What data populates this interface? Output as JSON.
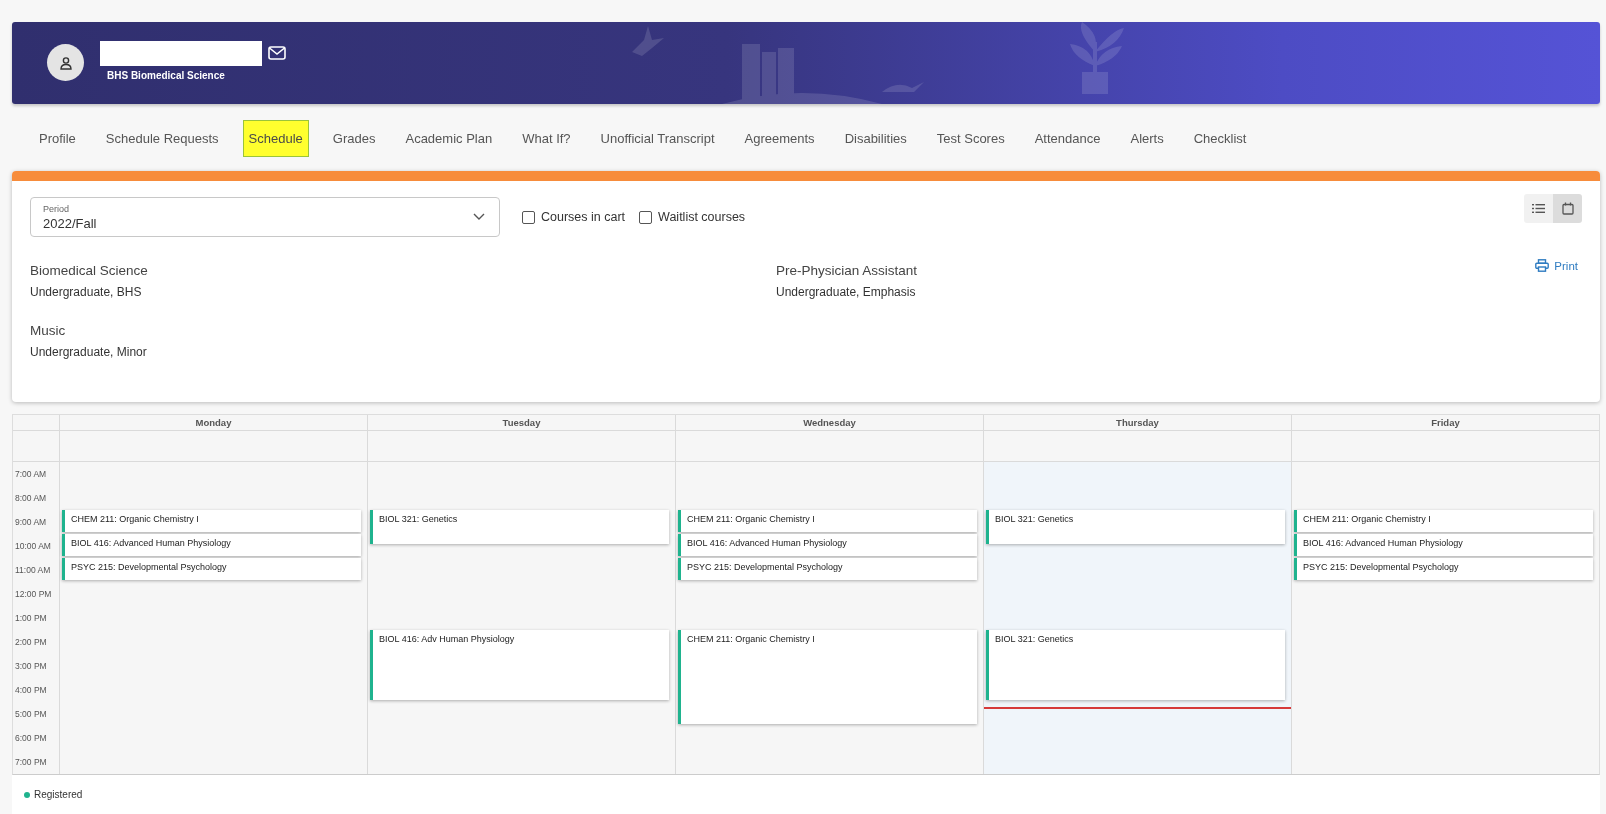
{
  "header": {
    "subtitle": "BHS Biomedical Science"
  },
  "tabs": [
    {
      "label": "Profile",
      "selected": false
    },
    {
      "label": "Schedule Requests",
      "selected": false
    },
    {
      "label": "Schedule",
      "selected": true
    },
    {
      "label": "Grades",
      "selected": false
    },
    {
      "label": "Academic Plan",
      "selected": false
    },
    {
      "label": "What If?",
      "selected": false
    },
    {
      "label": "Unofficial Transcript",
      "selected": false
    },
    {
      "label": "Agreements",
      "selected": false
    },
    {
      "label": "Disabilities",
      "selected": false
    },
    {
      "label": "Test Scores",
      "selected": false
    },
    {
      "label": "Attendance",
      "selected": false
    },
    {
      "label": "Alerts",
      "selected": false
    },
    {
      "label": "Checklist",
      "selected": false
    }
  ],
  "period": {
    "label": "Period",
    "value": "2022/Fall"
  },
  "filters": [
    {
      "label": "Courses in cart",
      "checked": false
    },
    {
      "label": "Waitlist courses",
      "checked": false
    }
  ],
  "view_toggle": [
    {
      "kind": "list",
      "selected": false
    },
    {
      "kind": "calendar",
      "selected": true
    }
  ],
  "programs": [
    {
      "name": "Biomedical Science",
      "detail": "Undergraduate, BHS"
    },
    {
      "name": "Pre-Physician Assistant",
      "detail": "Undergraduate, Emphasis"
    },
    {
      "name": "Music",
      "detail": "Undergraduate, Minor"
    }
  ],
  "print": "Print",
  "calendar": {
    "times": [
      "7:00 AM",
      "8:00 AM",
      "9:00 AM",
      "10:00 AM",
      "11:00 AM",
      "12:00 PM",
      "1:00 PM",
      "2:00 PM",
      "3:00 PM",
      "4:00 PM",
      "5:00 PM",
      "6:00 PM",
      "7:00 PM"
    ],
    "days": [
      {
        "name": "Monday",
        "today": false,
        "blocks": [
          {
            "kind": "free2h"
          },
          {
            "kind": "course1h",
            "title": "CHEM 211: Organic Chemistry I"
          },
          {
            "kind": "course1h",
            "title": "BIOL 416: Advanced Human Physiology"
          },
          {
            "kind": "course1h",
            "title": "PSYC 215: Developmental Psychology"
          }
        ]
      },
      {
        "name": "Tuesday",
        "today": false,
        "blocks": [
          {
            "kind": "free2h"
          },
          {
            "kind": "course90m",
            "title": "BIOL 321: Genetics"
          },
          {
            "kind": "free3h30m"
          },
          {
            "kind": "course3h",
            "title": "BIOL 416: Adv Human Physiology"
          }
        ]
      },
      {
        "name": "Wednesday",
        "today": false,
        "blocks": [
          {
            "kind": "free2h"
          },
          {
            "kind": "course1h",
            "title": "CHEM 211: Organic Chemistry I"
          },
          {
            "kind": "course1h",
            "title": "BIOL 416: Advanced Human Physiology"
          },
          {
            "kind": "course1h",
            "title": "PSYC 215: Developmental Psychology"
          },
          {
            "kind": "free2h"
          },
          {
            "kind": "course4h",
            "title": "CHEM 211: Organic Chemistry I"
          }
        ]
      },
      {
        "name": "Thursday",
        "today": true,
        "blocks": [
          {
            "kind": "free2h"
          },
          {
            "kind": "course90m",
            "title": "BIOL 321: Genetics"
          },
          {
            "kind": "free3h30m"
          },
          {
            "kind": "course3h",
            "title": "BIOL 321: Genetics"
          },
          {
            "kind": "now"
          }
        ]
      },
      {
        "name": "Friday",
        "today": false,
        "blocks": [
          {
            "kind": "free2h"
          },
          {
            "kind": "course1h",
            "title": "CHEM 211: Organic Chemistry I"
          },
          {
            "kind": "course1h",
            "title": "BIOL 416: Advanced Human Physiology"
          },
          {
            "kind": "course1h",
            "title": "PSYC 215: Developmental Psychology"
          }
        ]
      }
    ]
  },
  "legend": [
    {
      "label": "Registered",
      "color": "#1fb38e"
    }
  ]
}
